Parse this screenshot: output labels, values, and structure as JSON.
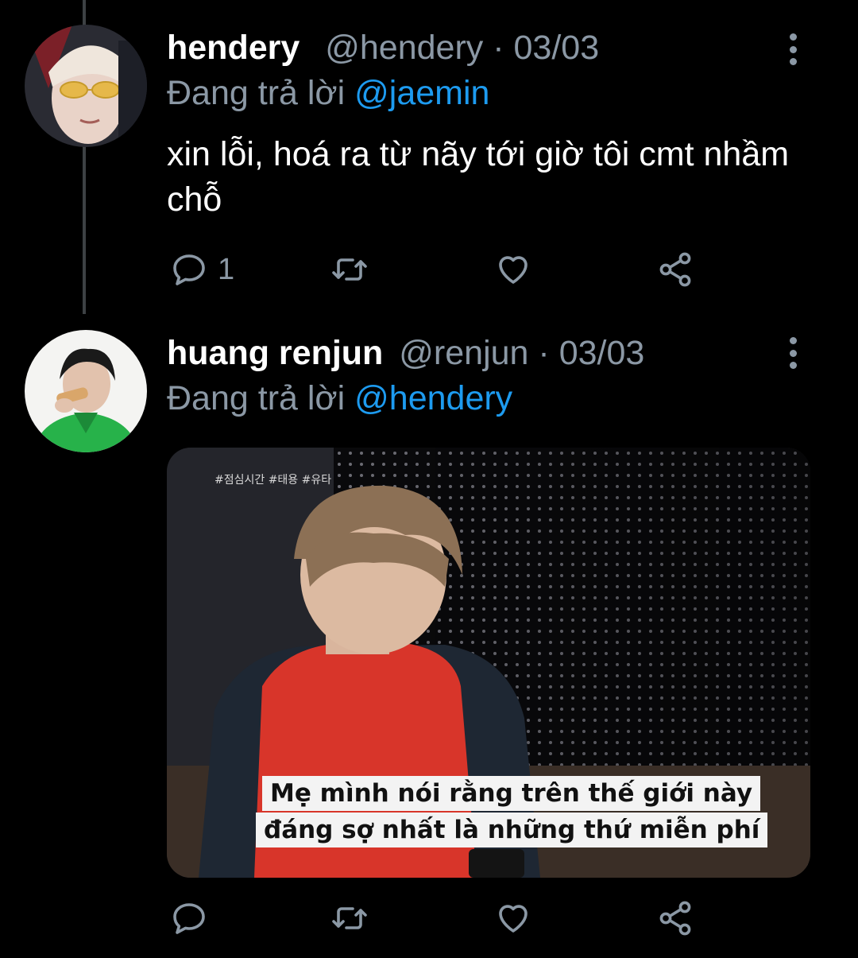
{
  "tweets": [
    {
      "name": "hendery",
      "handle": "@hendery",
      "separator": "·",
      "date": "03/03",
      "reply_prefix": "Đang trả lời",
      "reply_to": "@jaemin",
      "text": "xin lỗi, hoá ra từ nãy tới giờ tôi cmt nhầm chỗ",
      "reply_count": "1"
    },
    {
      "name": "huang renjun",
      "handle": "@renjun",
      "separator": "·",
      "date": "03/03",
      "reply_prefix": "Đang trả lời",
      "reply_to": "@hendery",
      "media": {
        "subtitle_line1": "Mẹ mình nói rằng trên thế giới này",
        "subtitle_line2": "đáng sợ nhất là những thứ miễn phí",
        "overlay_tags": "#점심시간 #태용 #유타"
      }
    }
  ],
  "colors": {
    "background": "#000000",
    "secondary_text": "#8b98a5",
    "mention": "#1d9bf0"
  },
  "icons": [
    "reply-icon",
    "retweet-icon",
    "like-icon",
    "share-icon",
    "more-options-icon"
  ]
}
